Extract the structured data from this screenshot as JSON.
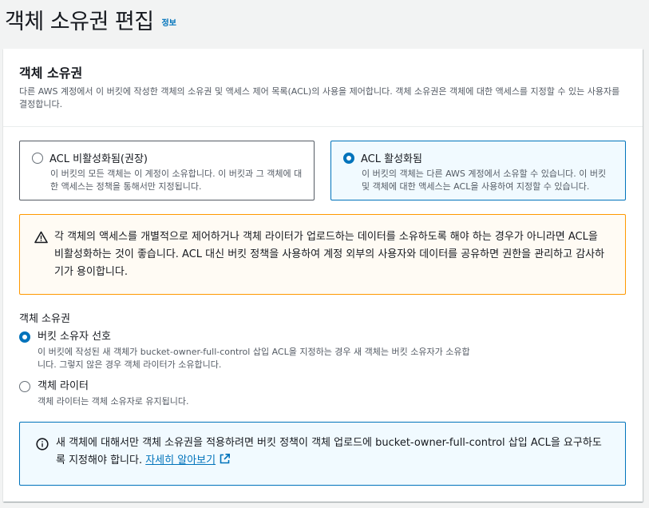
{
  "page": {
    "title": "객체 소유권 편집",
    "info_link": "정보"
  },
  "panel": {
    "title": "객체 소유권",
    "description": "다른 AWS 계정에서 이 버킷에 작성한 객체의 소유권 및 액세스 제어 목록(ACL)의 사용을 제어합니다. 객체 소유권은 객체에 대한 액세스를 지정할 수 있는 사용자를 결정합니다."
  },
  "acl_tiles": [
    {
      "label": "ACL 비활성화됨(권장)",
      "description": "이 버킷의 모든 객체는 이 계정이 소유합니다. 이 버킷과 그 객체에 대한 액세스는 정책을 통해서만 지정됩니다.",
      "selected": false
    },
    {
      "label": "ACL 활성화됨",
      "description": "이 버킷의 객체는 다른 AWS 계정에서 소유할 수 있습니다. 이 버킷 및 객체에 대한 액세스는 ACL을 사용하여 지정할 수 있습니다.",
      "selected": true
    }
  ],
  "warning": {
    "icon": "warning-icon",
    "text": "각 객체의 액세스를 개별적으로 제어하거나 객체 라이터가 업로드하는 데이터를 소유하도록 해야 하는 경우가 아니라면 ACL을 비활성화하는 것이 좋습니다. ACL 대신 버킷 정책을 사용하여 계정 외부의 사용자와 데이터를 공유하면 권한을 관리하고 감사하기가 용이합니다."
  },
  "ownership": {
    "label": "객체 소유권",
    "options": [
      {
        "label": "버킷 소유자 선호",
        "description": "이 버킷에 작성된 새 객체가 bucket-owner-full-control 삽입 ACL을 지정하는 경우 새 객체는 버킷 소유자가 소유합니다. 그렇지 않은 경우 객체 라이터가 소유합니다.",
        "selected": true
      },
      {
        "label": "객체 라이터",
        "description": "객체 라이터는 객체 소유자로 유지됩니다.",
        "selected": false
      }
    ]
  },
  "info_box": {
    "icon": "info-icon",
    "text": "새 객체에 대해서만 객체 소유권을 적용하려면 버킷 정책이 객체 업로드에 bucket-owner-full-control 삽입 ACL을 요구하도록 지정해야 합니다.",
    "link_label": "자세히 알아보기",
    "link_icon": "external-link-icon"
  },
  "colors": {
    "accent": "#0073bb",
    "warning": "#ff9900",
    "text": "#16191f",
    "muted": "#545b64"
  }
}
